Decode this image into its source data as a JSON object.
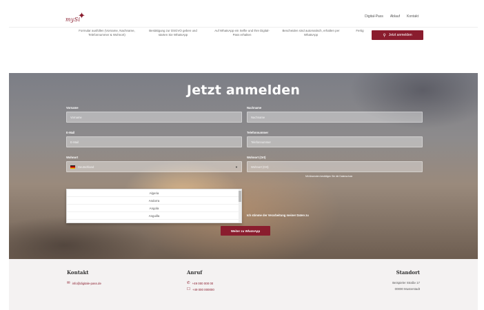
{
  "header": {
    "brand": "mySi",
    "nav": [
      "Digital-Pass",
      "Ablauf",
      "Kontakt"
    ]
  },
  "features": {
    "items": [
      "Formular ausfüllen (Vorname, Nachname, Telefonnummer & Wohnort)",
      "Bestätigung zur DSGVO geben und starten Sie WhatsApp",
      "Auf WhatsApp ein Selfie und Ihre Digital-Pass erhalten",
      "Bescheiden sind automatisch, erhalten per WhatsApp",
      "Fertig"
    ],
    "cta_label": "Jetzt anmelden"
  },
  "form": {
    "title": "Jetzt anmelden",
    "firstname_label": "Vorname",
    "firstname_placeholder": "Vorname",
    "lastname_label": "Nachname",
    "lastname_placeholder": "Nachname",
    "email_label": "E-Mail",
    "email_placeholder": "E-Mail",
    "phone_label": "Telefonnummer",
    "phone_placeholder": "Telefonnummer",
    "country_label": "Wohnort",
    "country_value": "Deutschland",
    "city_label": "Wohnort (Ort)",
    "city_placeholder": "Wohnort (Ort)",
    "city_hint": "Mit Absenden bestätigen Sie die Datenschutz",
    "dropdown_options": [
      "Algeria",
      "Andorra",
      "Angola",
      "Anguilla"
    ],
    "consent": "Ich stimme der Verarbeitung meiner Daten zu",
    "submit_label": "Weiter zu WhatsApp"
  },
  "footer": {
    "contact_title": "Kontakt",
    "contact_email": "info@digitale-pass.de",
    "call_title": "Anruf",
    "call_phone": "+49 000 000 00",
    "call_fax": "+49 000 000000",
    "location_title": "Standort",
    "location_street": "Beispieler Straße 17",
    "location_city": "00000 Musterstadt"
  },
  "colors": {
    "accent": "#8a1d2e",
    "footer_bg": "#f4f2f2"
  }
}
